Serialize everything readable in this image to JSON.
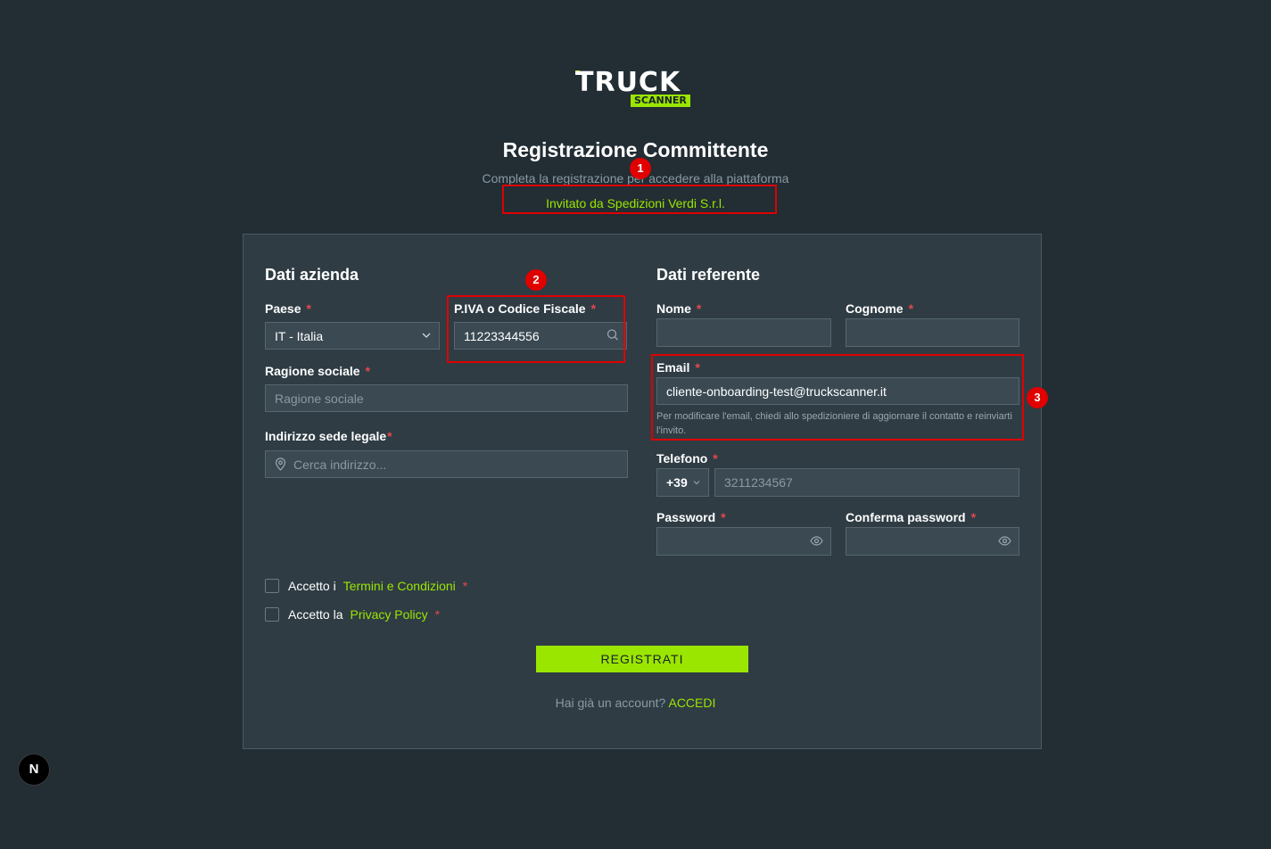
{
  "logo": {
    "word1": "TRUCK",
    "word2": "SCANNER"
  },
  "header": {
    "title": "Registrazione Committente",
    "subtitle": "Completa la registrazione per accedere alla piattaforma",
    "invited": "Invitato da Spedizioni Verdi S.r.l."
  },
  "annotations": [
    "1",
    "2",
    "3"
  ],
  "company": {
    "section_title": "Dati azienda",
    "country": {
      "label": "Paese",
      "value": "IT - Italia"
    },
    "vat": {
      "label": "P.IVA o Codice Fiscale",
      "value": "11223344556"
    },
    "business_name": {
      "label": "Ragione sociale",
      "placeholder": "Ragione sociale"
    },
    "address": {
      "label": "Indirizzo sede legale",
      "placeholder": "Cerca indirizzo..."
    }
  },
  "contact": {
    "section_title": "Dati referente",
    "first_name": {
      "label": "Nome",
      "value": ""
    },
    "last_name": {
      "label": "Cognome",
      "value": ""
    },
    "email": {
      "label": "Email",
      "value": "cliente-onboarding-test@truckscanner.it",
      "hint": "Per modificare l'email, chiedi allo spedizioniere di aggiornare il contatto e reinviarti l'invito."
    },
    "phone": {
      "label": "Telefono",
      "prefix": "+39",
      "placeholder": "3211234567"
    },
    "password": {
      "label": "Password"
    },
    "confirm_password": {
      "label": "Conferma password"
    }
  },
  "terms": {
    "prefix": "Accetto i",
    "link": "Termini e Condizioni"
  },
  "privacy": {
    "prefix": "Accetto la",
    "link": "Privacy Policy"
  },
  "required_mark": "*",
  "register_button": "REGISTRATI",
  "footer": {
    "text": "Hai già un account?",
    "link": "ACCEDI"
  },
  "dev_badge": "N",
  "colors": {
    "accent": "#9ae600",
    "background": "#222d34",
    "card": "#2f3c44",
    "annotation": "#e00000",
    "required": "#e5484d"
  }
}
